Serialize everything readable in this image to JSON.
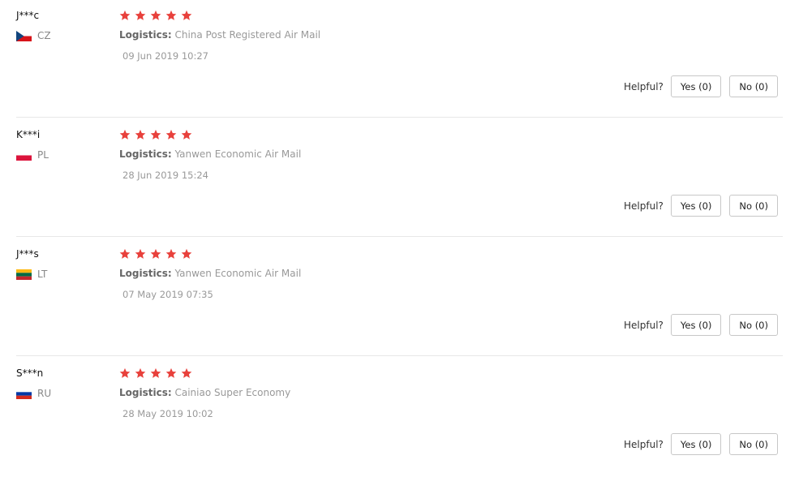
{
  "reviews": [
    {
      "user": "J***c",
      "country": "CZ",
      "rating": 5,
      "logistics_label": "Logistics:",
      "logistics": "China Post Registered Air Mail",
      "date": "09 Jun 2019 10:27",
      "helpful_label": "Helpful?",
      "yes_label": "Yes (0)",
      "no_label": "No (0)"
    },
    {
      "user": "K***i",
      "country": "PL",
      "rating": 5,
      "logistics_label": "Logistics:",
      "logistics": "Yanwen Economic Air Mail",
      "date": "28 Jun 2019 15:24",
      "helpful_label": "Helpful?",
      "yes_label": "Yes (0)",
      "no_label": "No (0)"
    },
    {
      "user": "J***s",
      "country": "LT",
      "rating": 5,
      "logistics_label": "Logistics:",
      "logistics": "Yanwen Economic Air Mail",
      "date": "07 May 2019 07:35",
      "helpful_label": "Helpful?",
      "yes_label": "Yes (0)",
      "no_label": "No (0)"
    },
    {
      "user": "S***n",
      "country": "RU",
      "rating": 5,
      "logistics_label": "Logistics:",
      "logistics": "Cainiao Super Economy",
      "date": "28 May 2019 10:02",
      "helpful_label": "Helpful?",
      "yes_label": "Yes (0)",
      "no_label": "No (0)"
    }
  ],
  "colors": {
    "star": "#e8413c",
    "flag_cz": [
      "#ffffff",
      "#d7141a",
      "#11457e"
    ],
    "flag_pl": [
      "#ffffff",
      "#dc143c"
    ],
    "flag_lt": [
      "#fdb913",
      "#006a44",
      "#c1272d"
    ],
    "flag_ru": [
      "#ffffff",
      "#0039a6",
      "#d52b1e"
    ]
  },
  "icons": {
    "star": "star-icon",
    "flag": "flag-icon"
  }
}
